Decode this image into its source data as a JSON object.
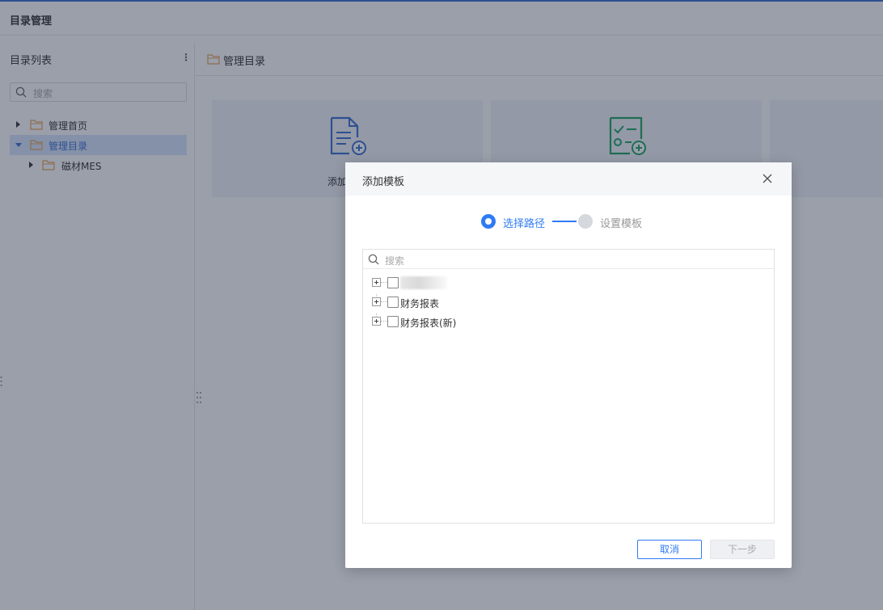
{
  "header": {
    "title": "目录管理"
  },
  "sidebar": {
    "title": "目录列表",
    "search_placeholder": "搜索",
    "tree": [
      {
        "label": "管理首页",
        "expanded": false,
        "selected": false,
        "level": 0
      },
      {
        "label": "管理目录",
        "expanded": true,
        "selected": true,
        "level": 0
      },
      {
        "label": "磁材MES",
        "expanded": false,
        "selected": false,
        "level": 1
      }
    ]
  },
  "main": {
    "breadcrumb": "管理目录",
    "cards": [
      {
        "label": "添加",
        "icon": "document-add-icon",
        "color": "#3b6fd4"
      },
      {
        "label": "",
        "icon": "checklist-add-icon",
        "color": "#1fa463"
      }
    ]
  },
  "dialog": {
    "title": "添加模板",
    "steps": [
      {
        "label": "选择路径",
        "active": true
      },
      {
        "label": "设置模板",
        "active": false
      }
    ],
    "search_placeholder": "搜索",
    "tree": [
      {
        "label": "",
        "redacted": true
      },
      {
        "label": "财务报表",
        "redacted": false
      },
      {
        "label": "财务报表(新)",
        "redacted": false
      }
    ],
    "buttons": {
      "cancel": "取消",
      "next": "下一步"
    }
  },
  "colors": {
    "primary": "#2f7bf5",
    "folder": "#e8a35a",
    "overlay": "rgba(31, 42, 66, 0.45)",
    "green_icon": "#1fa463"
  }
}
